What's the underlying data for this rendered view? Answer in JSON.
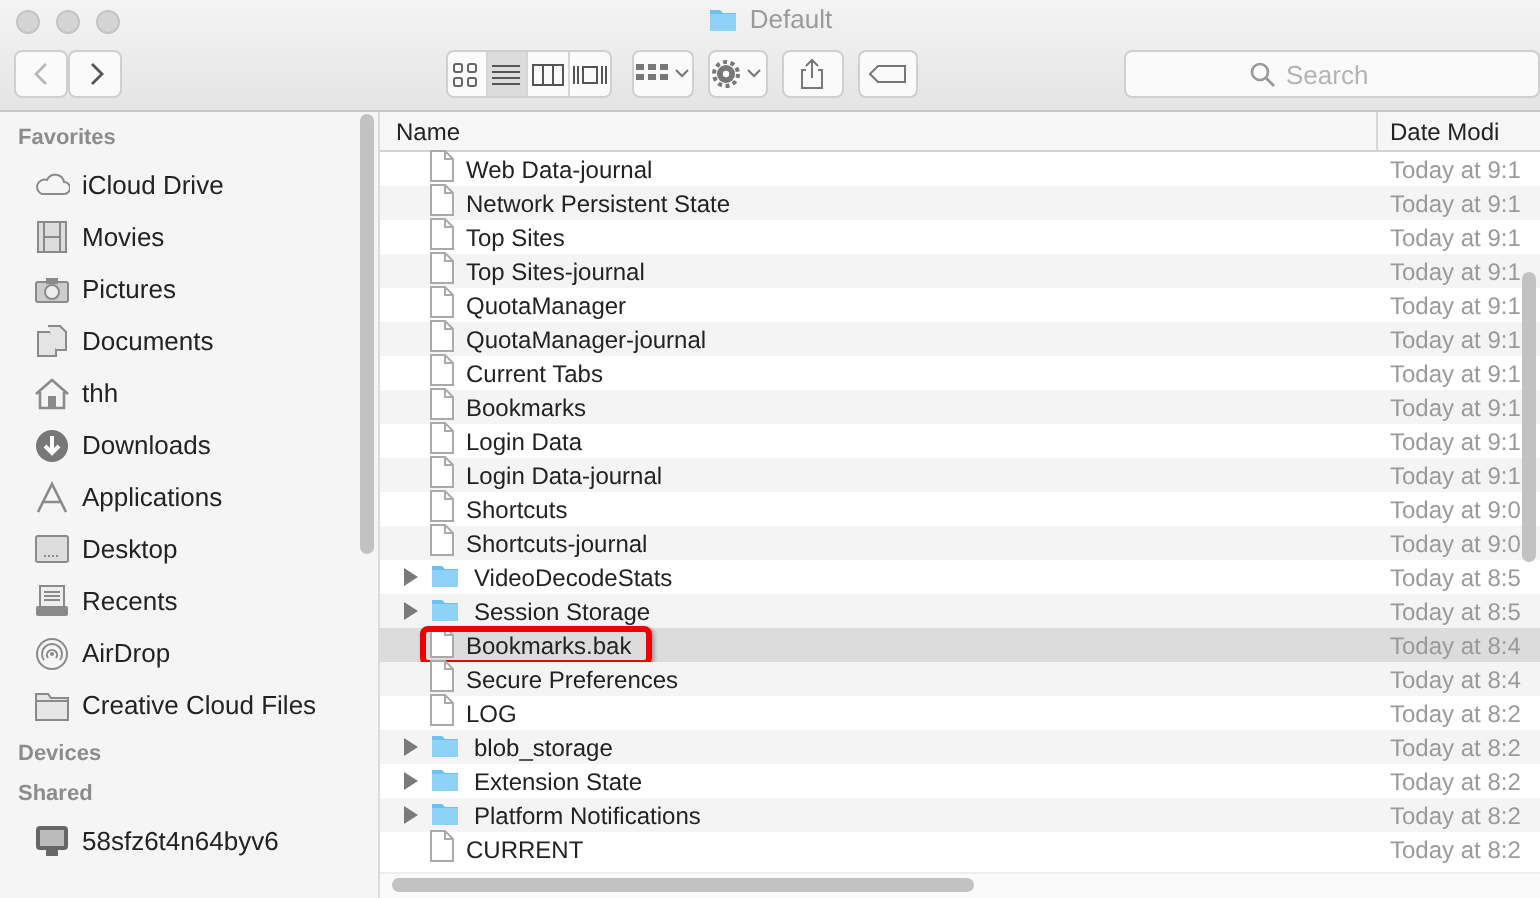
{
  "window": {
    "title": "Default"
  },
  "toolbar": {
    "back": {
      "disabled": true
    },
    "forward": {
      "disabled": false
    },
    "views": [
      {
        "kind": "icons",
        "selected": false
      },
      {
        "kind": "list",
        "selected": true
      },
      {
        "kind": "columns",
        "selected": false
      },
      {
        "kind": "gallery",
        "selected": false
      }
    ],
    "search": {
      "placeholder": "Search"
    }
  },
  "sidebar": {
    "sections": [
      {
        "title": "Favorites",
        "items": [
          {
            "kind": "cloud",
            "label": "iCloud Drive"
          },
          {
            "kind": "film",
            "label": "Movies"
          },
          {
            "kind": "camera",
            "label": "Pictures"
          },
          {
            "kind": "docs",
            "label": "Documents"
          },
          {
            "kind": "home",
            "label": "thh"
          },
          {
            "kind": "download",
            "label": "Downloads"
          },
          {
            "kind": "apps",
            "label": "Applications"
          },
          {
            "kind": "desktop",
            "label": "Desktop"
          },
          {
            "kind": "recents",
            "label": "Recents"
          },
          {
            "kind": "airdrop",
            "label": "AirDrop"
          },
          {
            "kind": "folder",
            "label": "Creative Cloud Files"
          }
        ]
      },
      {
        "title": "Devices"
      },
      {
        "title": "Shared",
        "items": [
          {
            "kind": "monitor",
            "label": "58sfz6t4n64byv6"
          }
        ]
      }
    ]
  },
  "table": {
    "columns": [
      "Name",
      "Date Modi"
    ],
    "rows": [
      {
        "kind": "file",
        "name": "Web Data-journal",
        "date": "Today at 9:1",
        "selected": false
      },
      {
        "kind": "file",
        "name": "Network Persistent State",
        "date": "Today at 9:1",
        "selected": false
      },
      {
        "kind": "file",
        "name": "Top Sites",
        "date": "Today at 9:1",
        "selected": false
      },
      {
        "kind": "file",
        "name": "Top Sites-journal",
        "date": "Today at 9:1",
        "selected": false
      },
      {
        "kind": "file",
        "name": "QuotaManager",
        "date": "Today at 9:1",
        "selected": false
      },
      {
        "kind": "file",
        "name": "QuotaManager-journal",
        "date": "Today at 9:1",
        "selected": false
      },
      {
        "kind": "file",
        "name": "Current Tabs",
        "date": "Today at 9:1",
        "selected": false
      },
      {
        "kind": "file",
        "name": "Bookmarks",
        "date": "Today at 9:1",
        "selected": false
      },
      {
        "kind": "file",
        "name": "Login Data",
        "date": "Today at 9:1",
        "selected": false
      },
      {
        "kind": "file",
        "name": "Login Data-journal",
        "date": "Today at 9:1",
        "selected": false
      },
      {
        "kind": "file",
        "name": "Shortcuts",
        "date": "Today at 9:0",
        "selected": false
      },
      {
        "kind": "file",
        "name": "Shortcuts-journal",
        "date": "Today at 9:0",
        "selected": false
      },
      {
        "kind": "folder",
        "name": "VideoDecodeStats",
        "date": "Today at 8:5",
        "selected": false,
        "expanded": false
      },
      {
        "kind": "folder",
        "name": "Session Storage",
        "date": "Today at 8:5",
        "selected": false,
        "expanded": false
      },
      {
        "kind": "file",
        "name": "Bookmarks.bak",
        "date": "Today at 8:4",
        "selected": true,
        "annotated": true
      },
      {
        "kind": "file",
        "name": "Secure Preferences",
        "date": "Today at 8:4",
        "selected": false
      },
      {
        "kind": "file",
        "name": "LOG",
        "date": "Today at 8:2",
        "selected": false
      },
      {
        "kind": "folder",
        "name": "blob_storage",
        "date": "Today at 8:2",
        "selected": false,
        "expanded": false
      },
      {
        "kind": "folder",
        "name": "Extension State",
        "date": "Today at 8:2",
        "selected": false,
        "expanded": false
      },
      {
        "kind": "folder",
        "name": "Platform Notifications",
        "date": "Today at 8:2",
        "selected": false,
        "expanded": false
      },
      {
        "kind": "file",
        "name": "CURRENT",
        "date": "Today at 8:2",
        "selected": false
      }
    ]
  }
}
